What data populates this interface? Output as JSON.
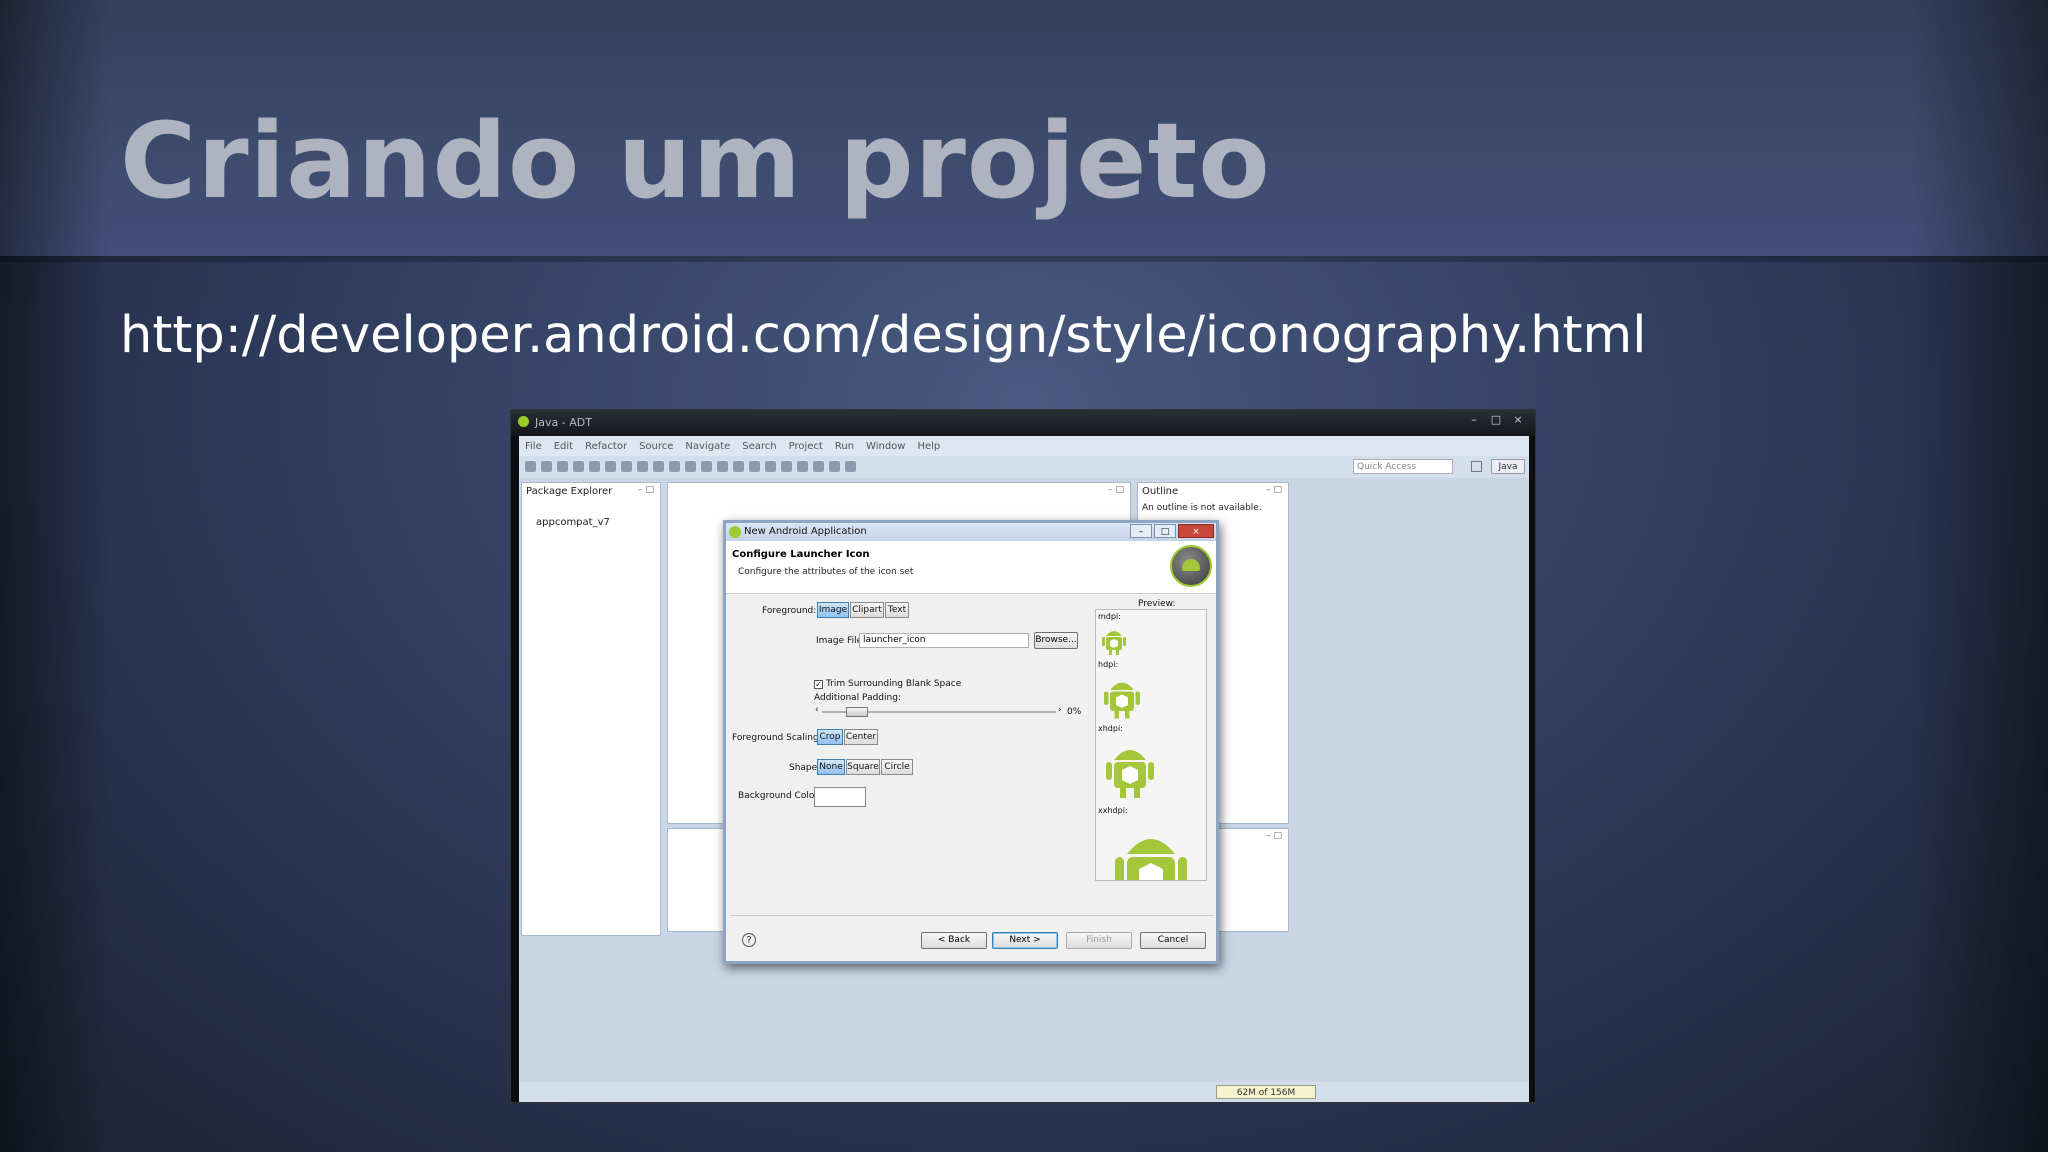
{
  "slide": {
    "title": "Criando um projeto",
    "url": "http://developer.android.com/design/style/iconography.html"
  },
  "window": {
    "title": "Java - ADT",
    "buttons": [
      "–",
      "□",
      "×"
    ]
  },
  "menubar": [
    "File",
    "Edit",
    "Refactor",
    "Source",
    "Navigate",
    "Search",
    "Project",
    "Run",
    "Window",
    "Help"
  ],
  "toolbar": {
    "quick_access_placeholder": "Quick Access",
    "perspective_label": "Java"
  },
  "package_explorer": {
    "tab_label": "Package Explorer",
    "items": [
      "appcompat_v7"
    ]
  },
  "outline": {
    "tab_label": "Outline",
    "message": "An outline is not available."
  },
  "status": {
    "heap": "62M of 156M"
  },
  "dialog": {
    "title": "New Android Application",
    "header_title": "Configure Launcher Icon",
    "header_subtitle": "Configure the attributes of the icon set",
    "foreground_label": "Foreground:",
    "foreground_options": [
      "Image",
      "Clipart",
      "Text"
    ],
    "foreground_selected": "Image",
    "image_file_label": "Image File:",
    "image_file_value": "launcher_icon",
    "browse_label": "Browse...",
    "trim_label": "Trim Surrounding Blank Space",
    "trim_checked": true,
    "padding_label": "Additional Padding:",
    "padding_value": "0%",
    "scaling_label": "Foreground Scaling:",
    "scaling_options": [
      "Crop",
      "Center"
    ],
    "scaling_selected": "Crop",
    "shape_label": "Shape",
    "shape_options": [
      "None",
      "Square",
      "Circle"
    ],
    "shape_selected": "None",
    "bg_color_label": "Background Color:",
    "preview_label": "Preview:",
    "densities": [
      "mdpi:",
      "hdpi:",
      "xhdpi:",
      "xxhdpi:"
    ],
    "buttons": {
      "back": "< Back",
      "next": "Next >",
      "finish": "Finish",
      "cancel": "Cancel"
    },
    "help_glyph": "?"
  },
  "colors": {
    "android_green": "#a4c639",
    "selection_blue": "#8fc3ef"
  }
}
